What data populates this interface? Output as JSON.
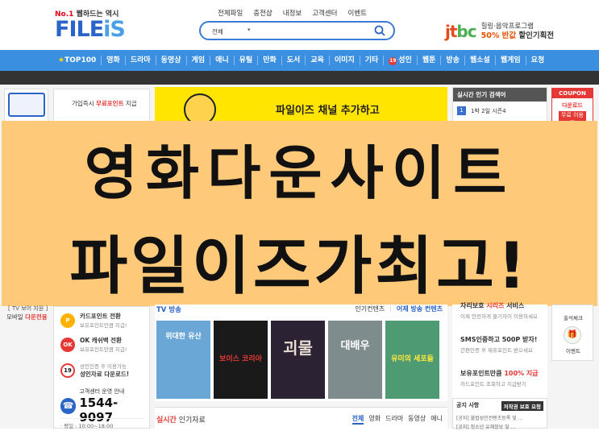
{
  "brand": {
    "tagline_prefix": "No.1",
    "tagline": "웹하드는 역시",
    "name_part1": "FILE",
    "name_part2": "iS"
  },
  "topnav": [
    "전체파일",
    "충전샵",
    "내정보",
    "고객센터",
    "이벤트"
  ],
  "search": {
    "category": "전체",
    "value": ""
  },
  "jtbc": {
    "logo_a": "jt",
    "logo_b": "bc",
    "line1": "힐링·음악프로그램",
    "line2_highlight": "50% 반값",
    "line2_rest": " 할인기획전"
  },
  "categories": [
    "TOP100",
    "영화",
    "드라마",
    "동영상",
    "게임",
    "애니",
    "유틸",
    "만화",
    "도서",
    "교육",
    "이미지",
    "기타",
    "성인",
    "웹툰",
    "방송",
    "웹소설",
    "웹게임",
    "요청"
  ],
  "adult_badge": "19",
  "promo": {
    "prefix": "가입즉시 ",
    "highlight": "무료포인트",
    "suffix": " 지급"
  },
  "banner": {
    "text": "파일이즈 채널 추가하고"
  },
  "rank_box": {
    "title": "실시간 인기 검색어",
    "first_num": "1",
    "first_item": "1박 2일 시즌4"
  },
  "coupon": {
    "title": "COUPON",
    "line1": "다운로드",
    "line2": "무료 이용권"
  },
  "overlay": {
    "line1": "영화다운사이트",
    "line2": "파일이즈가최고!"
  },
  "left_lower": {
    "line1": "[ TV 보어 지원 ]",
    "line2_prefix": "모바일 ",
    "line2_highlight": "다운전용"
  },
  "sidebox": {
    "items": [
      {
        "icon": "P",
        "title": "카드포인트 전환",
        "sub": "보유포인트만큼 지급!"
      },
      {
        "icon": "OK",
        "title": "OK 캐쉬백 전환",
        "sub": "보유포인트만큼 지급!"
      },
      {
        "icon": "19",
        "title": "성인자료 다운로드!",
        "sub": "성인인증 후 이용가능"
      }
    ],
    "cs_label": "고객센터 운영 안내",
    "cs_phone": "1544-9097",
    "hours": "· 평일 : 10:00~18:00"
  },
  "tv": {
    "title": "TV 방송",
    "tabs": [
      "인기컨텐츠",
      "어제 방송 컨텐츠"
    ],
    "posters": [
      {
        "title": "위대한 유산",
        "bg": "#6aa6d6"
      },
      {
        "title": "보이스 코리아",
        "bg": "#1a1a1a"
      },
      {
        "title": "괴물",
        "bg": "#2b2233"
      },
      {
        "title": "대배우",
        "bg": "#7f8c8d"
      },
      {
        "title": "유미의 세포들",
        "bg": "#4e9a73"
      }
    ]
  },
  "realtime": {
    "title_highlight": "실시간",
    "title_rest": " 인기자료",
    "tabs": [
      "전체",
      "영화",
      "드라마",
      "동영상",
      "애니"
    ]
  },
  "rightcol": {
    "item1_title_prefix": "자리보호 ",
    "item1_title_highlight": "시리즈",
    "item1_title_suffix": " 서비스",
    "item1_sub": "이제 안전하게 즐기자이 이용하세요",
    "item2_title": "SMS인증하고 500P 받자!",
    "item2_sub": "간편인증 후 제휴포인트 받으세요",
    "item3_title_prefix": "보유포인트만큼 ",
    "item3_title_highlight": "100% 지급",
    "item3_sub": "카드포인트 조회하고 지급받기"
  },
  "notice": {
    "title": "공지 사항",
    "badge": "저작권 보호 요청",
    "lines": [
      "[공지] 불법성인컨텐츠등록 및 ...",
      "[공지] 청소년 유해정보 및 ..."
    ]
  },
  "iconcol": [
    {
      "label": "출석체크"
    },
    {
      "label": "이벤트"
    }
  ],
  "colors": {
    "accent": "#3a8fe0",
    "brand": "#2a64c8",
    "highlight": "#e53935",
    "overlay": "#ffc97a"
  }
}
